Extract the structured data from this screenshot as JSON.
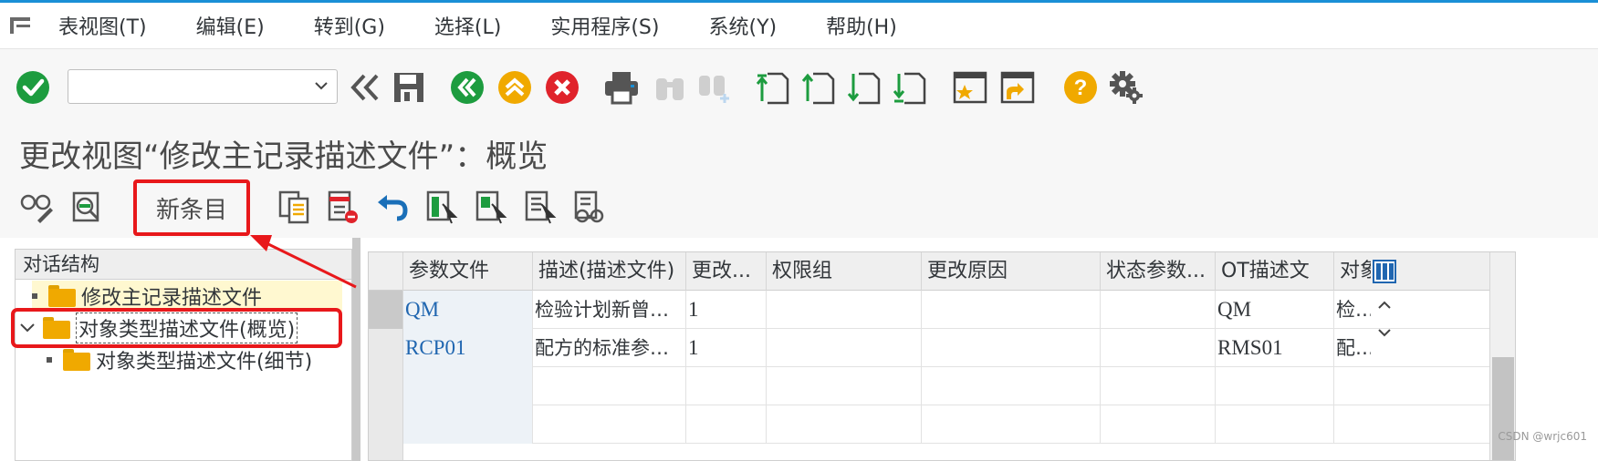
{
  "menu": {
    "items": [
      "表视图(T)",
      "编辑(E)",
      "转到(G)",
      "选择(L)",
      "实用程序(S)",
      "系统(Y)",
      "帮助(H)"
    ]
  },
  "toolbar": {
    "command_field_value": "",
    "icons": [
      "enter-icon",
      "back-double-icon",
      "save-icon",
      "back-icon",
      "exit-icon",
      "cancel-icon",
      "print-icon",
      "find-icon",
      "find-next-icon",
      "first-page-icon",
      "previous-page-icon",
      "next-page-icon",
      "last-page-icon",
      "create-session-icon",
      "shortcut-icon",
      "help-icon",
      "settings-icon"
    ]
  },
  "page": {
    "title": "更改视图“修改主记录描述文件”：概览"
  },
  "app_toolbar": {
    "new_entry_label": "新条目"
  },
  "tree": {
    "header": "对话结构",
    "items": [
      {
        "label": "修改主记录描述文件",
        "level": 1
      },
      {
        "label": "对象类型描述文件(概览)",
        "level": 1,
        "selected": true,
        "expanded": true
      },
      {
        "label": "对象类型描述文件(细节)",
        "level": 2
      }
    ]
  },
  "table": {
    "columns": [
      "参数文件",
      "描述(描述文件)",
      "更改...",
      "权限组",
      "更改原因",
      "状态参数...",
      "OT描述文",
      "对象"
    ],
    "rows": [
      [
        "QM",
        "检验计划新曾升…",
        "1",
        "",
        "",
        "",
        "QM",
        "检验"
      ],
      [
        "RCP01",
        "配方的标准参数…",
        "1",
        "",
        "",
        "",
        "RMS01",
        "配方"
      ]
    ]
  },
  "watermark": "CSDN @wrjc601",
  "colors": {
    "accent": "#1a8fd6",
    "highlight": "#e8181b",
    "folder": "#f0a900",
    "key_text": "#2066b0"
  }
}
